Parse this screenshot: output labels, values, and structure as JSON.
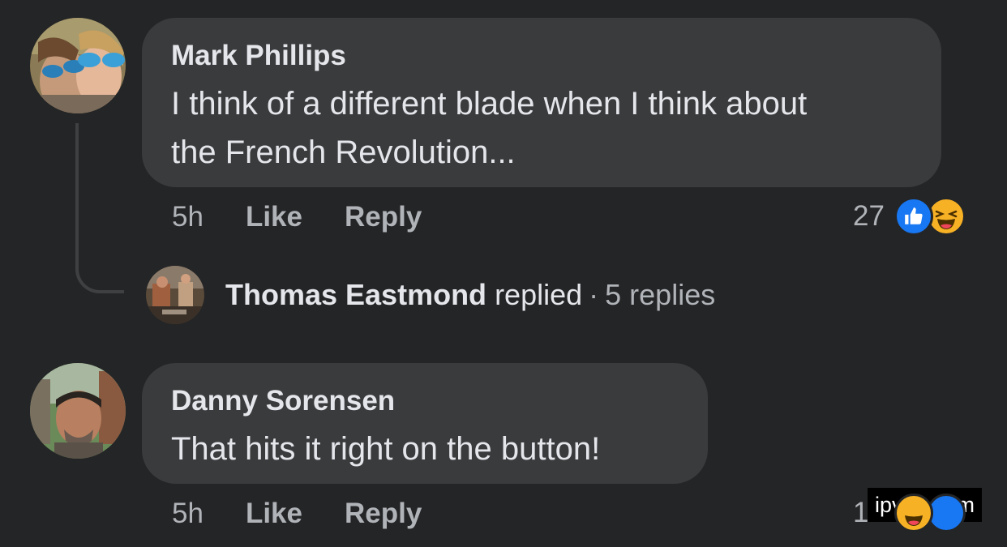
{
  "comments": [
    {
      "author": "Mark Phillips",
      "text_line1": "I think of a different blade when I think about",
      "text_line2": "the French Revolution...",
      "time": "5h",
      "like_label": "Like",
      "reply_label": "Reply",
      "reaction_count": "27",
      "reactions": [
        "like-icon",
        "haha-icon"
      ]
    },
    {
      "author": "Danny Sorensen",
      "text_line1": "That hits it right on the button!",
      "time": "5h",
      "like_label": "Like",
      "reply_label": "Reply",
      "reaction_count": "12",
      "reactions": [
        "haha-icon",
        "like-icon"
      ]
    }
  ],
  "replies_summary": {
    "name": "Thomas Eastmond",
    "verb": "replied",
    "separator": "·",
    "count_label": "5 replies"
  },
  "watermark": "ipv69.com",
  "colors": {
    "background": "#242526",
    "bubble": "#3a3b3c",
    "primary_text": "#e4e6eb",
    "secondary_text": "#b0b3b8",
    "like_blue": "#1877f2",
    "haha_yellow": "#f7b125"
  }
}
